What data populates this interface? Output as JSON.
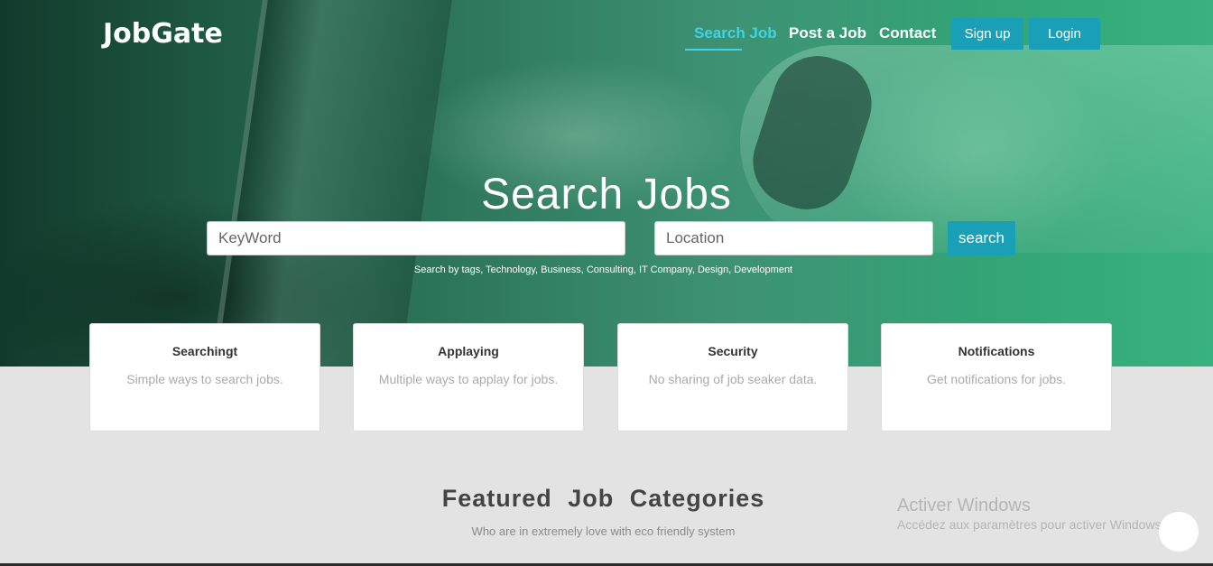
{
  "brand": {
    "logo": "JobGate"
  },
  "nav": {
    "links": [
      "Search Job",
      "Post a Job",
      "Contact"
    ],
    "signup": "Sign up",
    "login": "Login"
  },
  "hero": {
    "title": "Search Jobs",
    "keyword_placeholder": "KeyWord",
    "location_placeholder": "Location",
    "search_button": "search",
    "tags_line": "Search by tags, Technology, Business, Consulting, IT Company, Design, Development"
  },
  "features": [
    {
      "title": "Searchingt",
      "desc": "Simple ways to search jobs."
    },
    {
      "title": "Applaying",
      "desc": "Multiple ways to applay for jobs."
    },
    {
      "title": "Security",
      "desc": "No sharing of job seaker data."
    },
    {
      "title": "Notifications",
      "desc": "Get notifications for jobs."
    }
  ],
  "featured": {
    "title": "Featured Job Categories",
    "subtitle": "Who are in extremely love with eco friendly system"
  },
  "watermark": {
    "title": "Activer Windows",
    "subtitle": "Accédez aux paramètres pour activer Windows."
  },
  "colors": {
    "accent": "#1aa0b6",
    "active_link": "#3fd3e6",
    "background": "#e3e3e3"
  }
}
